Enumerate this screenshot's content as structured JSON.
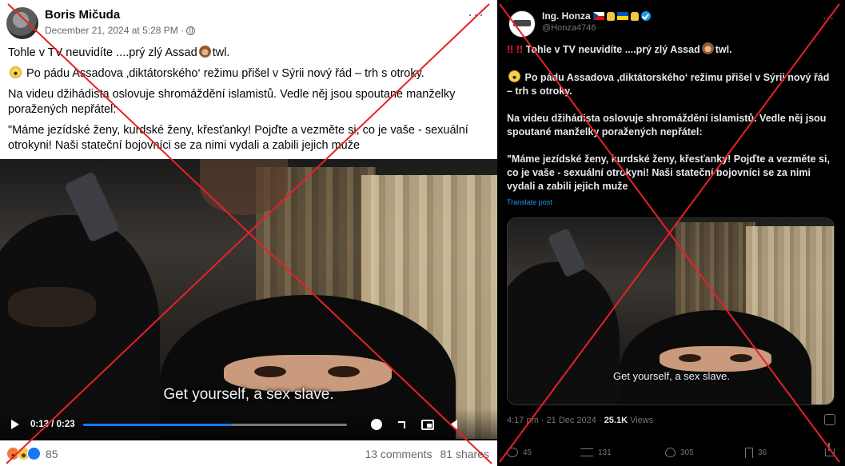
{
  "facebook": {
    "author": "Boris Mičuda",
    "timestamp": "December 21, 2024 at 5:28 PM ·",
    "more": "···",
    "para1": "Tohle v TV neuvidíte ....prý zlý Assad",
    "para1_end": "twl.",
    "para2": "Po pádu Assadova ‚diktátorského‘ režimu přišel v Sýrii nový řád – trh s otroky.",
    "para3": "Na videu džihádista oslovuje shromáždění islamistů. Vedle něj jsou spoutané manželky poražených nepřátel:",
    "para4": "\"Máme jezídské ženy, kurdské ženy, křesťanky! Pojďte a vezměte si, co je vaše - sexuální otrokyni! Naši stateční bojovníci se za nimi vydali a zabili jejich  muže",
    "subtitle": "Get yourself, a sex slave.",
    "video_time": "0:13 / 0:23",
    "video_progress": 0.565,
    "reaction_count": "85",
    "comments": "13 comments",
    "shares": "81 shares",
    "accent": "#1877f2"
  },
  "twitter": {
    "name": "Ing. Honza",
    "handle": "@Honza4746",
    "more": "···",
    "line1_prefix": "!! !!",
    "line1": "Tohle v TV neuvidíte ....prý zlý Assad",
    "line1_end": "twl.",
    "para2": "Po pádu Assadova ‚diktátorského‘ režimu přišel v Sýrii nový řád – trh s otroky.",
    "para3": "Na videu džihádista oslovuje shromáždění islamistů. Vedle něj jsou spoutané manželky poražených nepřátel:",
    "para4": "\"Máme jezídské ženy, kurdské ženy, křesťanky! Pojďte a vezměte si, co je vaše - sexuální otrokyni! Naši stateční bojovníci se za nimi vydali a zabili jejich  muže",
    "translate": "Translate post",
    "subtitle": "Get yourself, a sex slave.",
    "meta_time": "4:17 pm · 21 Dec 2024 · ",
    "views_count": "25.1K",
    "views_label": " Views",
    "replies": "45",
    "reposts": "131",
    "likes": "305",
    "bookmarks": "36",
    "accent": "#1d9bf0"
  },
  "overlay": {
    "cross_color": "#e8202a"
  }
}
